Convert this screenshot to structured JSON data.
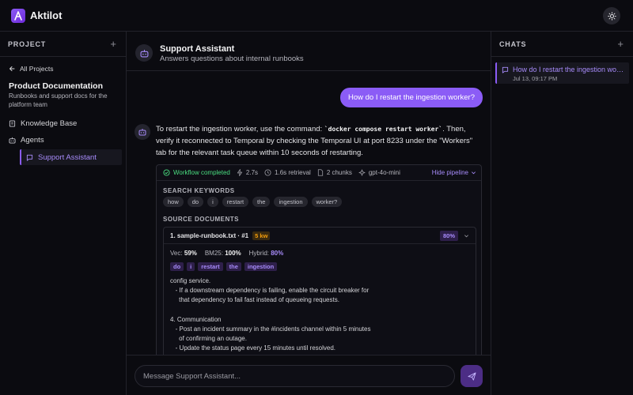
{
  "app": {
    "name": "Aktilot"
  },
  "left_panel": {
    "title": "PROJECT",
    "add_label": "+",
    "back_label": "All Projects",
    "project_name": "Product Documentation",
    "project_desc": "Runbooks and support docs for the platform team",
    "nav": [
      {
        "label": "Knowledge Base",
        "icon": "book-icon"
      },
      {
        "label": "Agents",
        "icon": "bot-icon"
      },
      {
        "label": "Support Assistant",
        "icon": "chat-bubble-icon"
      }
    ]
  },
  "agent": {
    "name": "Support Assistant",
    "description": "Answers questions about internal runbooks"
  },
  "conversation": {
    "user_message": "How do I restart the ingestion worker?",
    "bot_text_1": "To restart the ingestion worker, use the command: ",
    "bot_code": "`docker compose restart worker`",
    "bot_text_2": ". Then, verify it reconnected to Temporal by checking the Temporal UI at port 8233 under the \"Workers\" tab for the relevant task queue within 10 seconds of restarting."
  },
  "pipeline": {
    "status": "Workflow completed",
    "duration": "2.7s",
    "retrieval": "1.6s retrieval",
    "chunks": "2 chunks",
    "model": "gpt-4o-mini",
    "hide_label": "Hide pipeline",
    "search_keywords_label": "SEARCH KEYWORDS",
    "keywords": [
      "how",
      "do",
      "i",
      "restart",
      "the",
      "ingestion",
      "worker?"
    ],
    "source_documents_label": "SOURCE DOCUMENTS",
    "doc": {
      "title": "1. sample-runbook.txt · #1",
      "kw_badge": "5 kw",
      "score": "80%",
      "vec_label": "Vec:",
      "vec_value": "59%",
      "bm25_label": "BM25:",
      "bm25_value": "100%",
      "hybrid_label": "Hybrid:",
      "hybrid_value": "80%",
      "matched": [
        "do",
        "i",
        "restart",
        "the",
        "ingestion"
      ],
      "snippet": [
        "config service.",
        "   - If a downstream dependency is failing, enable the circuit breaker for",
        "     that dependency to fail fast instead of queueing requests.",
        "",
        "4. Communication",
        "   - Post an incident summary in the #incidents channel within 5 minutes",
        "     of confirming an outage.",
        "   - Update the status page every 15 minutes until resolved."
      ]
    }
  },
  "input": {
    "placeholder": "Message Support Assistant..."
  },
  "right_panel": {
    "title": "CHATS",
    "add_label": "+",
    "chats": [
      {
        "title": "How do I restart the ingestion worker?",
        "time": "Jul 13, 09:17 PM"
      }
    ]
  },
  "colors": {
    "accent": "#8b5cf6",
    "accent_text": "#a78bfa",
    "success": "#4ade80",
    "warning": "#f59e0b",
    "background": "#0b0b10"
  }
}
